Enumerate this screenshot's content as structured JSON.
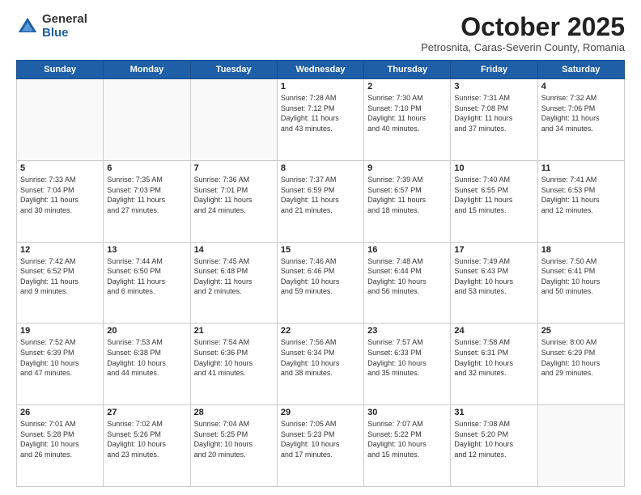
{
  "logo": {
    "general": "General",
    "blue": "Blue"
  },
  "header": {
    "month": "October 2025",
    "location": "Petrosnita, Caras-Severin County, Romania"
  },
  "days_of_week": [
    "Sunday",
    "Monday",
    "Tuesday",
    "Wednesday",
    "Thursday",
    "Friday",
    "Saturday"
  ],
  "weeks": [
    [
      {
        "day": "",
        "info": ""
      },
      {
        "day": "",
        "info": ""
      },
      {
        "day": "",
        "info": ""
      },
      {
        "day": "1",
        "info": "Sunrise: 7:28 AM\nSunset: 7:12 PM\nDaylight: 11 hours\nand 43 minutes."
      },
      {
        "day": "2",
        "info": "Sunrise: 7:30 AM\nSunset: 7:10 PM\nDaylight: 11 hours\nand 40 minutes."
      },
      {
        "day": "3",
        "info": "Sunrise: 7:31 AM\nSunset: 7:08 PM\nDaylight: 11 hours\nand 37 minutes."
      },
      {
        "day": "4",
        "info": "Sunrise: 7:32 AM\nSunset: 7:06 PM\nDaylight: 11 hours\nand 34 minutes."
      }
    ],
    [
      {
        "day": "5",
        "info": "Sunrise: 7:33 AM\nSunset: 7:04 PM\nDaylight: 11 hours\nand 30 minutes."
      },
      {
        "day": "6",
        "info": "Sunrise: 7:35 AM\nSunset: 7:03 PM\nDaylight: 11 hours\nand 27 minutes."
      },
      {
        "day": "7",
        "info": "Sunrise: 7:36 AM\nSunset: 7:01 PM\nDaylight: 11 hours\nand 24 minutes."
      },
      {
        "day": "8",
        "info": "Sunrise: 7:37 AM\nSunset: 6:59 PM\nDaylight: 11 hours\nand 21 minutes."
      },
      {
        "day": "9",
        "info": "Sunrise: 7:39 AM\nSunset: 6:57 PM\nDaylight: 11 hours\nand 18 minutes."
      },
      {
        "day": "10",
        "info": "Sunrise: 7:40 AM\nSunset: 6:55 PM\nDaylight: 11 hours\nand 15 minutes."
      },
      {
        "day": "11",
        "info": "Sunrise: 7:41 AM\nSunset: 6:53 PM\nDaylight: 11 hours\nand 12 minutes."
      }
    ],
    [
      {
        "day": "12",
        "info": "Sunrise: 7:42 AM\nSunset: 6:52 PM\nDaylight: 11 hours\nand 9 minutes."
      },
      {
        "day": "13",
        "info": "Sunrise: 7:44 AM\nSunset: 6:50 PM\nDaylight: 11 hours\nand 6 minutes."
      },
      {
        "day": "14",
        "info": "Sunrise: 7:45 AM\nSunset: 6:48 PM\nDaylight: 11 hours\nand 2 minutes."
      },
      {
        "day": "15",
        "info": "Sunrise: 7:46 AM\nSunset: 6:46 PM\nDaylight: 10 hours\nand 59 minutes."
      },
      {
        "day": "16",
        "info": "Sunrise: 7:48 AM\nSunset: 6:44 PM\nDaylight: 10 hours\nand 56 minutes."
      },
      {
        "day": "17",
        "info": "Sunrise: 7:49 AM\nSunset: 6:43 PM\nDaylight: 10 hours\nand 53 minutes."
      },
      {
        "day": "18",
        "info": "Sunrise: 7:50 AM\nSunset: 6:41 PM\nDaylight: 10 hours\nand 50 minutes."
      }
    ],
    [
      {
        "day": "19",
        "info": "Sunrise: 7:52 AM\nSunset: 6:39 PM\nDaylight: 10 hours\nand 47 minutes."
      },
      {
        "day": "20",
        "info": "Sunrise: 7:53 AM\nSunset: 6:38 PM\nDaylight: 10 hours\nand 44 minutes."
      },
      {
        "day": "21",
        "info": "Sunrise: 7:54 AM\nSunset: 6:36 PM\nDaylight: 10 hours\nand 41 minutes."
      },
      {
        "day": "22",
        "info": "Sunrise: 7:56 AM\nSunset: 6:34 PM\nDaylight: 10 hours\nand 38 minutes."
      },
      {
        "day": "23",
        "info": "Sunrise: 7:57 AM\nSunset: 6:33 PM\nDaylight: 10 hours\nand 35 minutes."
      },
      {
        "day": "24",
        "info": "Sunrise: 7:58 AM\nSunset: 6:31 PM\nDaylight: 10 hours\nand 32 minutes."
      },
      {
        "day": "25",
        "info": "Sunrise: 8:00 AM\nSunset: 6:29 PM\nDaylight: 10 hours\nand 29 minutes."
      }
    ],
    [
      {
        "day": "26",
        "info": "Sunrise: 7:01 AM\nSunset: 5:28 PM\nDaylight: 10 hours\nand 26 minutes."
      },
      {
        "day": "27",
        "info": "Sunrise: 7:02 AM\nSunset: 5:26 PM\nDaylight: 10 hours\nand 23 minutes."
      },
      {
        "day": "28",
        "info": "Sunrise: 7:04 AM\nSunset: 5:25 PM\nDaylight: 10 hours\nand 20 minutes."
      },
      {
        "day": "29",
        "info": "Sunrise: 7:05 AM\nSunset: 5:23 PM\nDaylight: 10 hours\nand 17 minutes."
      },
      {
        "day": "30",
        "info": "Sunrise: 7:07 AM\nSunset: 5:22 PM\nDaylight: 10 hours\nand 15 minutes."
      },
      {
        "day": "31",
        "info": "Sunrise: 7:08 AM\nSunset: 5:20 PM\nDaylight: 10 hours\nand 12 minutes."
      },
      {
        "day": "",
        "info": ""
      }
    ]
  ]
}
